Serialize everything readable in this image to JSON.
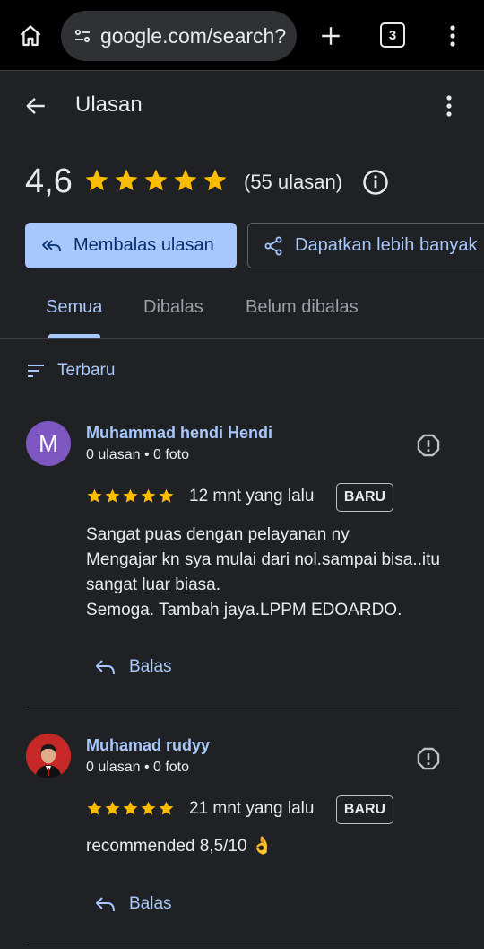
{
  "browser": {
    "url": "google.com/search?",
    "tab_count": "3"
  },
  "header": {
    "title": "Ulasan"
  },
  "summary": {
    "rating": "4,6",
    "stars": 5,
    "review_count": "(55 ulasan)"
  },
  "actions": {
    "reply_reviews": "Membalas ulasan",
    "get_more": "Dapatkan lebih banyak"
  },
  "tabs": [
    {
      "label": "Semua"
    },
    {
      "label": "Dibalas"
    },
    {
      "label": "Belum dibalas"
    }
  ],
  "sort": {
    "label": "Terbaru"
  },
  "reviews": [
    {
      "avatar_letter": "M",
      "avatar_color": "#7e57c2",
      "name": "Muhammad hendi Hendi",
      "meta": "0 ulasan • 0 foto",
      "stars": 5,
      "time": "12 mnt yang lalu",
      "badge": "BARU",
      "text": "Sangat puas dengan pelayanan ny\nMengajar kn sya mulai dari nol.sampai bisa..itu sangat luar biasa.\nSemoga. Tambah jaya.LPPM EDOARDO.",
      "reply_label": "Balas"
    },
    {
      "avatar_letter": "",
      "avatar_color": "#b71c1c",
      "name": "Muhamad rudyy",
      "meta": "0 ulasan • 0 foto",
      "stars": 5,
      "time": "21 mnt yang lalu",
      "badge": "BARU",
      "text": "recommended 8,5/10 👌",
      "reply_label": "Balas"
    }
  ],
  "colors": {
    "background": "#202124",
    "accent": "#a8c7fa",
    "star": "#fbbc04",
    "primary_button": "#a8c7fa"
  }
}
